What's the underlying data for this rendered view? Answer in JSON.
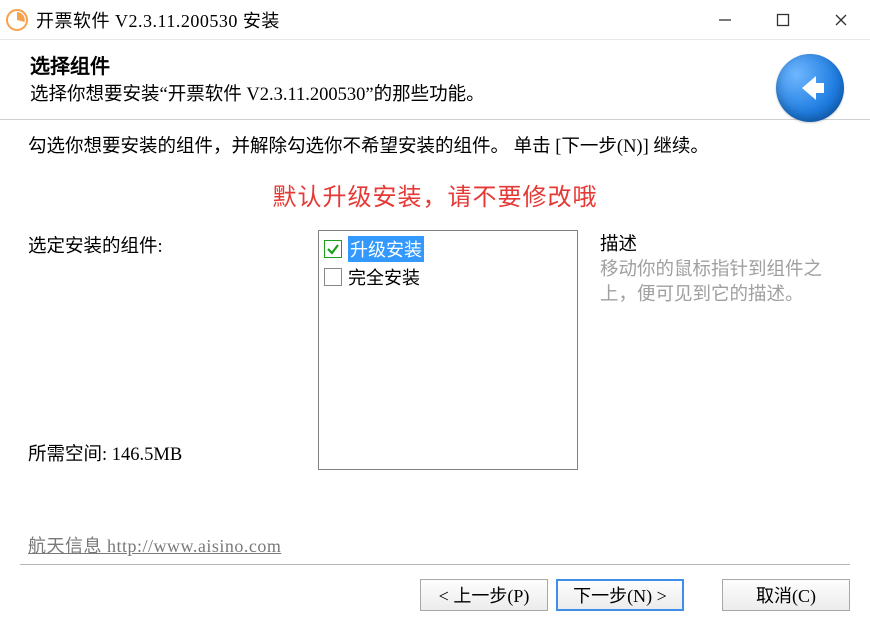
{
  "window": {
    "title": "开票软件 V2.3.11.200530 安装"
  },
  "header": {
    "title": "选择组件",
    "subtitle": "选择你想要安装“开票软件 V2.3.11.200530”的那些功能。"
  },
  "main": {
    "instruction": "勾选你想要安装的组件，并解除勾选你不希望安装的组件。 单击 [下一步(N)] 继续。",
    "warning": "默认升级安装，请不要修改哦",
    "select_label": "选定安装的组件:",
    "space_label": "所需空间: 146.5MB",
    "items": [
      {
        "label": "升级安装",
        "checked": true,
        "selected": true
      },
      {
        "label": "完全安装",
        "checked": false,
        "selected": false
      }
    ],
    "desc_title": "描述",
    "desc_body": "移动你的鼠标指针到组件之上，便可见到它的描述。"
  },
  "footer": {
    "branding": "航天信息 http://www.aisino.com",
    "back": "< 上一步(P)",
    "next": "下一步(N) >",
    "cancel": "取消(C)"
  }
}
